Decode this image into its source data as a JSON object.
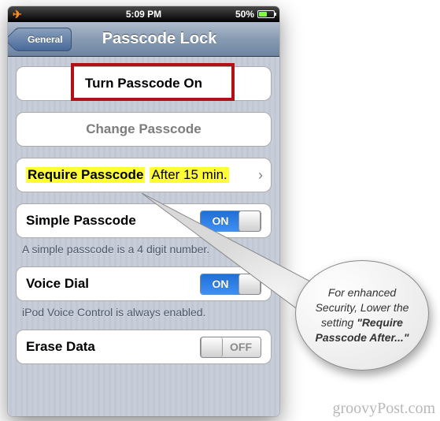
{
  "statusbar": {
    "time": "5:09 PM",
    "battery_pct": "50%"
  },
  "nav": {
    "back_label": "General",
    "title": "Passcode Lock"
  },
  "cells": {
    "turn_on": "Turn Passcode On",
    "change": "Change Passcode",
    "require_label": "Require Passcode",
    "require_value": "After 15 min.",
    "simple_label": "Simple Passcode",
    "simple_footer": "A simple passcode is a 4 digit number.",
    "voice_label": "Voice Dial",
    "voice_footer": "iPod Voice Control is always enabled.",
    "erase_label": "Erase Data"
  },
  "toggles": {
    "on_text": "ON",
    "off_text": "OFF"
  },
  "callout": {
    "text_pre": "For enhanced Security, Lower the setting ",
    "text_bold": "\"Require Passcode After...\""
  },
  "watermark": "groovyPost.com"
}
